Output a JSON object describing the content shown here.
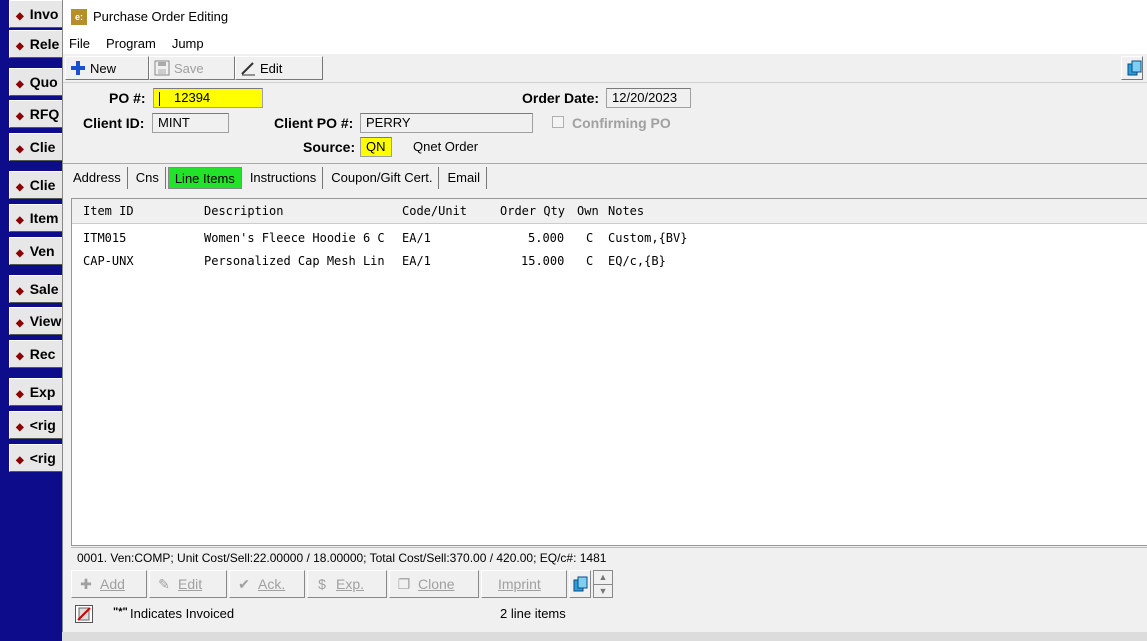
{
  "window": {
    "title": "Purchase Order Editing",
    "app_icon": "e:"
  },
  "menu": [
    "File",
    "Program",
    "Jump"
  ],
  "toolbar": {
    "new_label": "New",
    "save_label": "Save",
    "edit_label": "Edit"
  },
  "bg_menu": [
    "Invo",
    "Rele",
    "Quo",
    "RFQ",
    "Clie",
    "Clie",
    "Item",
    "Ven",
    "Sale",
    "View",
    "Rec",
    "Exp",
    "<rig",
    "<rig"
  ],
  "header": {
    "po_label": "PO #:",
    "po_value": "12394",
    "order_date_label": "Order Date:",
    "order_date_value": "12/20/2023",
    "client_id_label": "Client ID:",
    "client_id_value": "MINT",
    "client_po_label": "Client PO #:",
    "client_po_value": "PERRY",
    "confirming_label": "Confirming PO",
    "source_label": "Source:",
    "source_value": "QN",
    "source_desc": "Qnet Order"
  },
  "tabs": [
    "Address",
    "Cns",
    "Line Items",
    "Instructions",
    "Coupon/Gift Cert.",
    "Email"
  ],
  "grid": {
    "columns": [
      "Item ID",
      "Description",
      "Code/Unit",
      "Order Qty",
      "Own",
      "Notes"
    ],
    "rows": [
      {
        "item_id": "ITM015",
        "description": "Women's Fleece Hoodie 6 C",
        "code_unit": "EA/1",
        "qty": "5.000",
        "own": "C",
        "notes": "Custom,{BV}"
      },
      {
        "item_id": "CAP-UNX",
        "description": "Personalized Cap Mesh Lin",
        "code_unit": "EA/1",
        "qty": "15.000",
        "own": "C",
        "notes": "EQ/c,{B}"
      }
    ]
  },
  "status_line": "0001. Ven:COMP; Unit Cost/Sell:22.00000 / 18.00000; Total Cost/Sell:370.00 / 420.00; EQ/c#: 1481",
  "bottom_buttons": {
    "add": "Add",
    "edit": "Edit",
    "ack": "Ack.",
    "exp": "Exp.",
    "clone": "Clone",
    "imprint": "Imprint"
  },
  "footer": {
    "invoiced_mark": "\"*\"",
    "invoiced_text": "Indicates Invoiced",
    "line_count": "2 line items"
  }
}
